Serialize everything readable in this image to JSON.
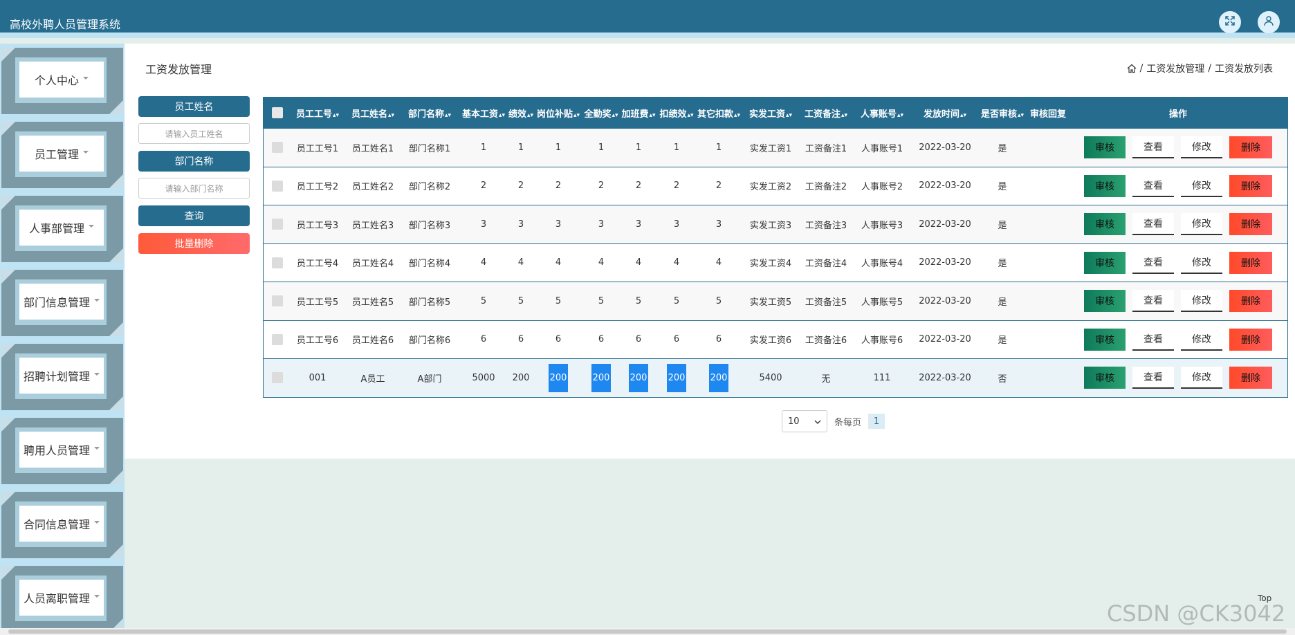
{
  "app": {
    "title": "高校外聘人员管理系统"
  },
  "sidebar": {
    "items": [
      {
        "label": "个人中心"
      },
      {
        "label": "员工管理"
      },
      {
        "label": "人事部管理"
      },
      {
        "label": "部门信息管理"
      },
      {
        "label": "招聘计划管理"
      },
      {
        "label": "聘用人员管理"
      },
      {
        "label": "合同信息管理"
      },
      {
        "label": "人员离职管理"
      }
    ]
  },
  "page": {
    "title": "工资发放管理",
    "breadcrumb": [
      "工资发放管理",
      "工资发放列表"
    ]
  },
  "search": {
    "name_label": "员工姓名",
    "name_placeholder": "请输入员工姓名",
    "dept_label": "部门名称",
    "dept_placeholder": "请输入部门名称",
    "query_label": "查询",
    "batch_delete_label": "批量删除"
  },
  "table": {
    "headers": [
      "员工工号",
      "员工姓名",
      "部门名称",
      "基本工资",
      "绩效",
      "岗位补贴",
      "全勤奖",
      "加班费",
      "扣绩效",
      "其它扣款",
      "实发工资",
      "工资备注",
      "人事账号",
      "发放时间",
      "是否审核",
      "审核回复",
      "操作"
    ],
    "rows": [
      [
        "员工工号1",
        "员工姓名1",
        "部门名称1",
        "1",
        "1",
        "1",
        "1",
        "1",
        "1",
        "1",
        "实发工资1",
        "工资备注1",
        "人事账号1",
        "2022-03-20",
        "是",
        ""
      ],
      [
        "员工工号2",
        "员工姓名2",
        "部门名称2",
        "2",
        "2",
        "2",
        "2",
        "2",
        "2",
        "2",
        "实发工资2",
        "工资备注2",
        "人事账号2",
        "2022-03-20",
        "是",
        ""
      ],
      [
        "员工工号3",
        "员工姓名3",
        "部门名称3",
        "3",
        "3",
        "3",
        "3",
        "3",
        "3",
        "3",
        "实发工资3",
        "工资备注3",
        "人事账号3",
        "2022-03-20",
        "是",
        ""
      ],
      [
        "员工工号4",
        "员工姓名4",
        "部门名称4",
        "4",
        "4",
        "4",
        "4",
        "4",
        "4",
        "4",
        "实发工资4",
        "工资备注4",
        "人事账号4",
        "2022-03-20",
        "是",
        ""
      ],
      [
        "员工工号5",
        "员工姓名5",
        "部门名称5",
        "5",
        "5",
        "5",
        "5",
        "5",
        "5",
        "5",
        "实发工资5",
        "工资备注5",
        "人事账号5",
        "2022-03-20",
        "是",
        ""
      ],
      [
        "员工工号6",
        "员工姓名6",
        "部门名称6",
        "6",
        "6",
        "6",
        "6",
        "6",
        "6",
        "6",
        "实发工资6",
        "工资备注6",
        "人事账号6",
        "2022-03-20",
        "是",
        ""
      ],
      [
        "001",
        "A员工",
        "A部门",
        "5000",
        "200",
        "200",
        "200",
        "200",
        "200",
        "200",
        "5400",
        "无",
        "111",
        "2022-03-20",
        "否",
        ""
      ]
    ],
    "actions": {
      "audit": "审核",
      "view": "查看",
      "edit": "修改",
      "delete": "删除"
    }
  },
  "pager": {
    "page_size": "10",
    "per_page_label": "条每页",
    "current_page": "1"
  },
  "footer": {
    "top_label": "Top",
    "watermark": "CSDN @CK3042"
  },
  "colors": {
    "primary": "#266c8f",
    "danger": "#ff5a3a",
    "success": "#1a8a62",
    "highlight": "#1e87f0"
  }
}
